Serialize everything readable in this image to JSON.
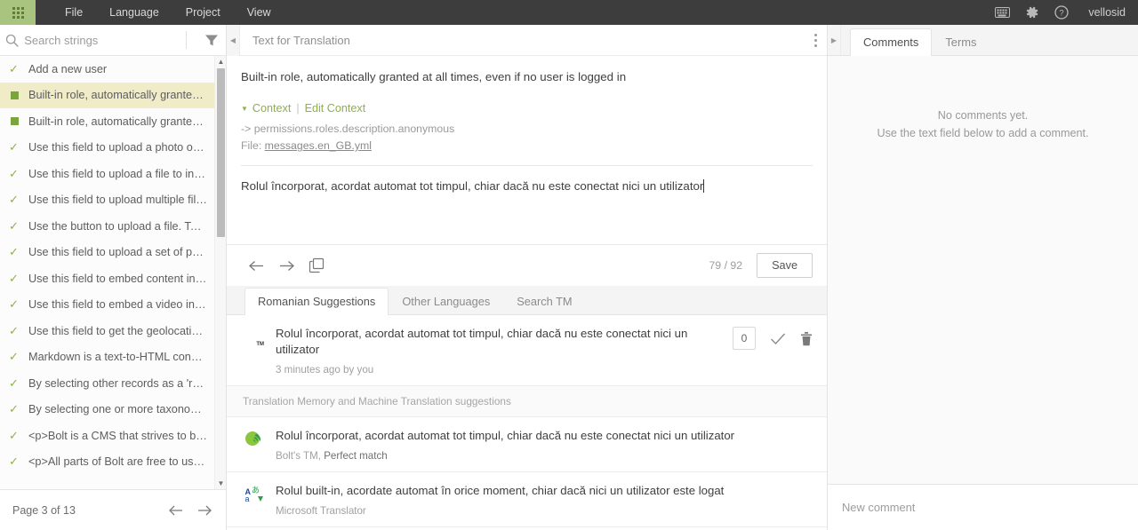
{
  "topbar": {
    "app_switcher_icon": "grid-apps-icon",
    "menu": [
      {
        "label": "File"
      },
      {
        "label": "Language"
      },
      {
        "label": "Project"
      },
      {
        "label": "View"
      }
    ],
    "icons": [
      {
        "name": "keyboard-icon"
      },
      {
        "name": "gear-icon"
      },
      {
        "name": "help-icon"
      }
    ],
    "username": "vellosid",
    "accent_green": "#a9c47f",
    "bar_background": "#3d3d3d"
  },
  "sidebar": {
    "search": {
      "placeholder": "Search strings",
      "value": "",
      "icon": "search-icon"
    },
    "filter_icon": "filter-funnel-icon",
    "items": [
      {
        "label": "Add a new user",
        "status": "check"
      },
      {
        "label": "Built-in role, automatically granted a...",
        "status": "square",
        "selected": true
      },
      {
        "label": "Built-in role, automatically granted t...",
        "status": "square"
      },
      {
        "label": "Use this field to upload a photo or i...",
        "status": "check"
      },
      {
        "label": "Use this field to upload a file to inclu...",
        "status": "check"
      },
      {
        "label": "Use this field to upload multiple files...",
        "status": "check"
      },
      {
        "label": "Use the button to upload a file. To s...",
        "status": "check"
      },
      {
        "label": "Use this field to upload a set of phot...",
        "status": "check"
      },
      {
        "label": "Use this field to embed content insi...",
        "status": "check"
      },
      {
        "label": "Use this field to embed a video insid...",
        "status": "check"
      },
      {
        "label": "Use this field to get the geolocation ...",
        "status": "check"
      },
      {
        "label": "Markdown is a text-to-HTML conver...",
        "status": "check"
      },
      {
        "label": "By selecting other records as a 'relat...",
        "status": "check"
      },
      {
        "label": "By selecting one or more taxonomie...",
        "status": "check"
      },
      {
        "label": "<p>Bolt is a CMS that strives to be si...",
        "status": "check"
      },
      {
        "label": "<p>All parts of Bolt are free to use u...",
        "status": "check"
      }
    ],
    "pager": {
      "label": "Page 3 of 13",
      "prev_icon": "arrow-left-icon",
      "next_icon": "arrow-right-icon"
    }
  },
  "center": {
    "header": {
      "title": "Text for Translation",
      "collapse_left_icon": "chevron-left-icon",
      "menu_icon": "kebab-menu-icon"
    },
    "source_text": "Built-in role, automatically granted at all times, even if no user is logged in",
    "context": {
      "caret_icon": "caret-down-icon",
      "toggle_label": "Context",
      "separator": "|",
      "edit_label": "Edit Context",
      "key_path": "-> permissions.roles.description.anonymous",
      "file_label": "File:",
      "file_name": "messages.en_GB.yml"
    },
    "translation": {
      "value": "Rolul încorporat, acordat automat tot timpul, chiar dacă nu este conectat nici un utilizator"
    },
    "toolbar": {
      "prev_icon": "arrow-left-icon",
      "next_icon": "arrow-right-icon",
      "copy_icon": "copy-source-icon",
      "char_count": "79 / 92",
      "save_label": "Save"
    },
    "suggestion_tabs": [
      {
        "label": "Romanian Suggestions",
        "active": true
      },
      {
        "label": "Other Languages",
        "active": false
      },
      {
        "label": "Search TM",
        "active": false
      }
    ],
    "user_suggestion": {
      "avatar": "user-avatar",
      "avatar_badge": "TM",
      "text": "Rolul încorporat, acordat automat tot timpul, chiar dacă nu este conectat nici un utilizator",
      "meta": "3 minutes ago by you",
      "vote_count": "0",
      "accept_icon": "check-icon",
      "delete_icon": "trash-icon"
    },
    "tm_header": "Translation Memory and Machine Translation suggestions",
    "tm_suggestions": [
      {
        "icon": "bolt-tm-icon",
        "text": "Rolul încorporat, acordat automat tot timpul, chiar dacă nu este conectat nici un utilizator",
        "source": "Bolt's TM,",
        "quality": "Perfect match"
      },
      {
        "icon": "microsoft-translator-icon",
        "text": "Rolul built-in, acordate automat în orice moment, chiar dacă nici un utilizator este logat",
        "source": "Microsoft Translator",
        "quality": ""
      }
    ]
  },
  "right_panel": {
    "collapse_icon": "chevron-right-icon",
    "tabs": [
      {
        "label": "Comments",
        "active": true
      },
      {
        "label": "Terms",
        "active": false
      }
    ],
    "empty_state_line1": "No comments yet.",
    "empty_state_line2": "Use the text field below to add a comment.",
    "comment_placeholder": "New comment"
  }
}
